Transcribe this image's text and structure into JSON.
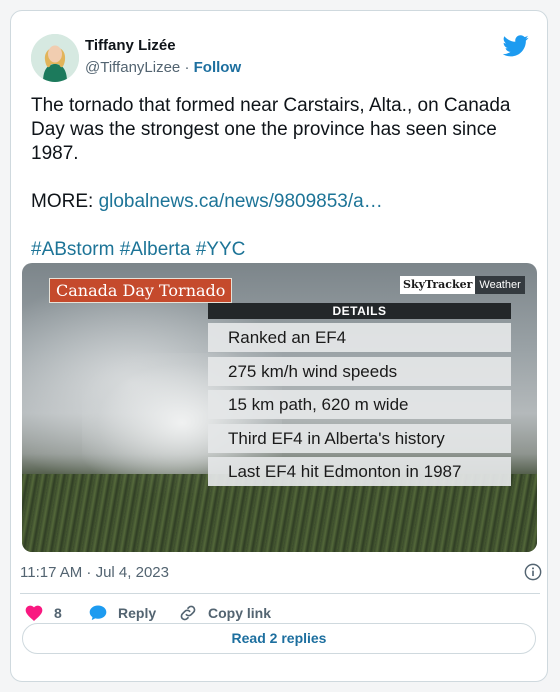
{
  "author": {
    "name": "Tiffany Lizée",
    "handle": "@TiffanyLizee",
    "separator": "·",
    "follow_label": "Follow"
  },
  "tweet": {
    "text": "The tornado that formed near Carstairs, Alta., on Canada Day was the strongest one the province has seen since 1987.",
    "more_label": "MORE: ",
    "link_text": "globalnews.ca/news/9809853/a…",
    "hashtags": "#ABstorm #Alberta #YYC"
  },
  "media": {
    "title": "Canada Day Tornado",
    "brand_a": "SkyTracker",
    "brand_b": "Weather",
    "details_header": "DETAILS",
    "details": [
      "Ranked an EF4",
      "275 km/h wind speeds",
      "15 km path, 620 m wide",
      "Third EF4 in Alberta's history",
      "Last EF4 hit Edmonton in 1987"
    ]
  },
  "meta": {
    "timestamp": "11:17 AM · Jul 4, 2023"
  },
  "actions": {
    "like_count": "8",
    "reply_label": "Reply",
    "copy_label": "Copy link",
    "read_replies_label": "Read 2 replies"
  },
  "colors": {
    "link": "#1d7497",
    "twitter_blue": "#1d9bf0",
    "heart": "#f91880",
    "title_bg": "#c54a2c"
  },
  "icons": [
    "twitter-bird-icon",
    "info-icon",
    "heart-icon",
    "reply-bubble-icon",
    "link-icon"
  ]
}
